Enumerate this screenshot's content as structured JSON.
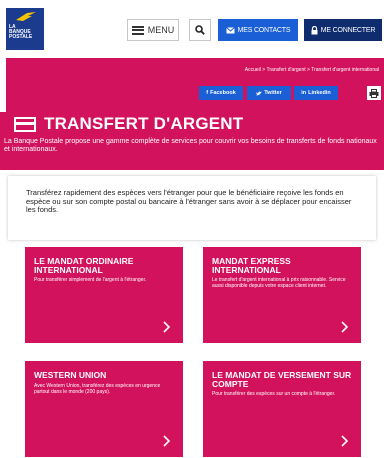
{
  "header": {
    "logo_lines": [
      "LA",
      "BANQUE",
      "POSTALE"
    ],
    "menu_label": "MENU",
    "contacts_label": "MES CONTACTS",
    "connect_label": "ME CONNECTER"
  },
  "breadcrumb": "Accueil > Transfert d'argent > Transfert d'argent international",
  "social": {
    "facebook": "Facebook",
    "twitter": "Twitter",
    "linkedin": "Linkedin"
  },
  "page": {
    "title": "TRANSFERT D'ARGENT",
    "intro": "La Banque Postale propose une gamme complète de services pour couvrir vos besoins de transferts de fonds nationaux et internationaux.",
    "box_text": "Transférez rapidement des espèces vers l'étranger pour que le bénéficiaire reçoive les fonds en espèce ou sur son compte postal ou bancaire à l'étranger sans avoir à se déplacer pour encaisser les fonds."
  },
  "tiles": [
    {
      "title": "LE MANDAT ORDINAIRE INTERNATIONAL",
      "desc": "Pour transférer simplement de l'argent à l'étranger."
    },
    {
      "title": "MANDAT EXPRESS INTERNATIONAL",
      "desc": "Le transfert d'argent international à prix raisonnable. Service aussi disponible depuis votre espace client internet."
    },
    {
      "title": "WESTERN UNION",
      "desc": "Avec Western Union, transférez des espèces en urgence partout dans le monde (200 pays)."
    },
    {
      "title": "LE MANDAT DE VERSEMENT SUR COMPTE",
      "desc": "Pour transférer des espèces sur un compte à l'étranger."
    }
  ],
  "colors": {
    "brand_pink": "#d3125e",
    "brand_blue": "#1a5fd6",
    "brand_navy": "#0f2c6e"
  }
}
